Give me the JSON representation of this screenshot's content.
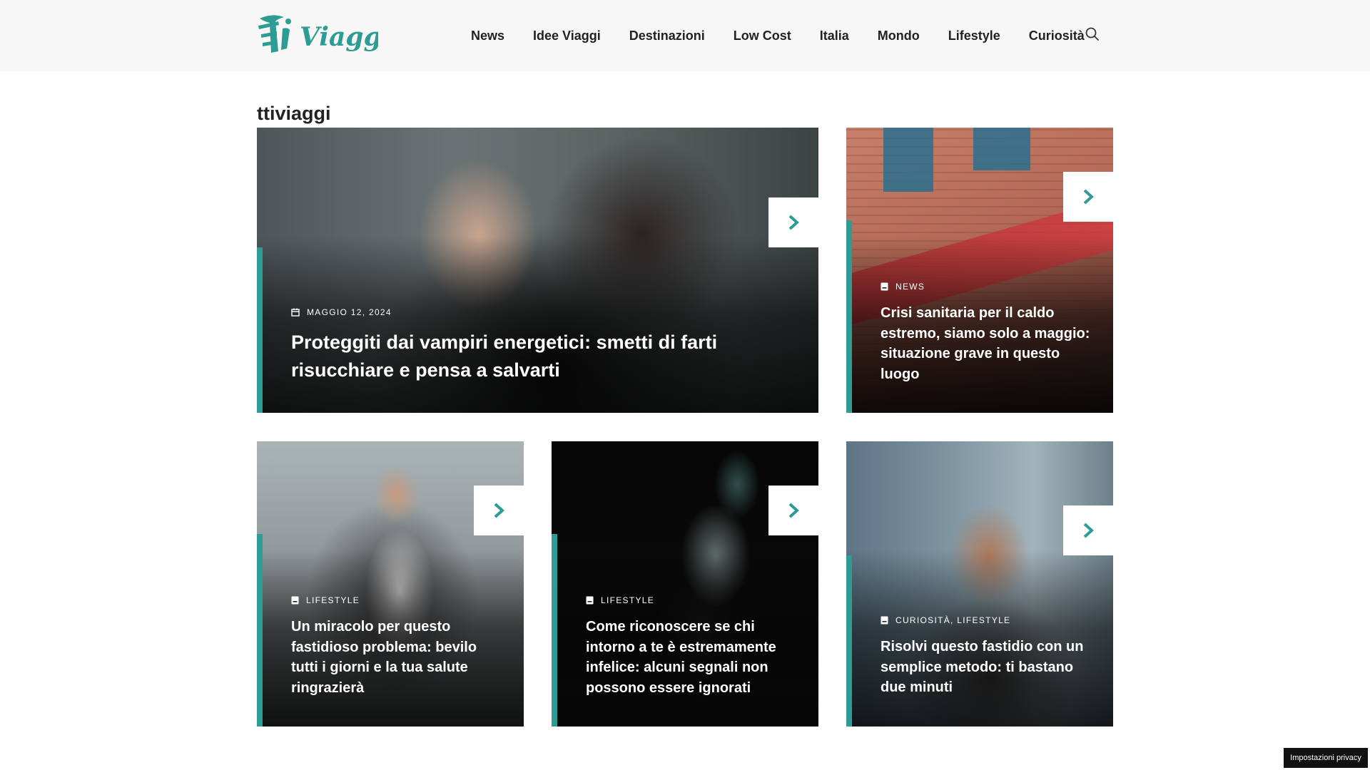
{
  "header": {
    "logo_text": "Ti Viaggi",
    "nav": [
      "News",
      "Idee Viaggi",
      "Destinazioni",
      "Low Cost",
      "Italia",
      "Mondo",
      "Lifestyle",
      "Curiosità"
    ],
    "search_icon": "search-icon"
  },
  "page_title": "ttiviaggi",
  "colors": {
    "accent": "#2e9c95",
    "header_bg": "#f7f7f7"
  },
  "cards": [
    {
      "meta": "MAGGIO 12, 2024",
      "meta_icon": "calendar-icon",
      "title": "Proteggiti dai vampiri energetici: smetti di farti risucchiare e pensa a salvarti"
    },
    {
      "meta": "NEWS",
      "meta_icon": "folder-icon",
      "title": "Crisi sanitaria per il caldo estremo, siamo solo a maggio: situazione grave in questo luogo"
    },
    {
      "meta": "LIFESTYLE",
      "meta_icon": "folder-icon",
      "title": "Un miracolo per questo fastidioso problema: bevilo tutti i giorni e la tua salute ringrazierà"
    },
    {
      "meta": "LIFESTYLE",
      "meta_icon": "folder-icon",
      "title": "Come riconoscere se chi intorno a te è estremamente infelice: alcuni segnali non possono essere ignorati"
    },
    {
      "meta": "CURIOSITÀ, LIFESTYLE",
      "meta_icon": "folder-icon",
      "title": "Risolvi questo fastidio con un semplice metodo: ti bastano due minuti"
    }
  ],
  "privacy_label": "Impostazioni privacy"
}
